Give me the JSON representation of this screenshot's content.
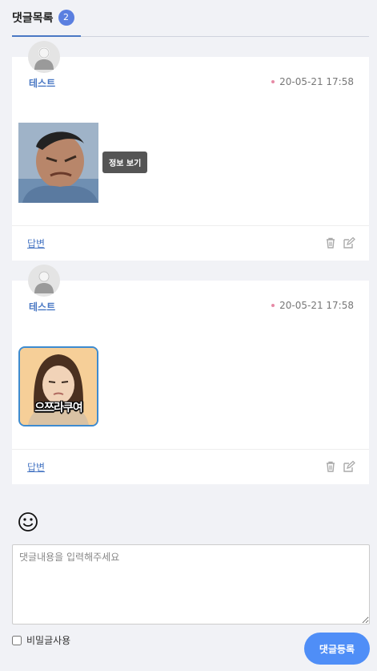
{
  "header": {
    "tab_label": "댓글목록",
    "count": "2"
  },
  "comments": [
    {
      "author": "테스트",
      "date": "20-05-21 17:58",
      "image": "photo-icon",
      "tooltip": "정보 보기",
      "reply_label": "답변"
    },
    {
      "author": "테스트",
      "date": "20-05-21 17:58",
      "image": "sticker-icon",
      "caption": "으쯔라쿠여",
      "reply_label": "답변"
    }
  ],
  "compose": {
    "emoji": "smiley-icon",
    "placeholder": "댓글내용을 입력해주세요",
    "value": "",
    "secret_label": "비밀글사용",
    "secret_checked": false,
    "submit_label": "댓글등록"
  },
  "colors": {
    "accent": "#4a78c4",
    "badge": "#5a7fe0",
    "submit": "#4f8ef7",
    "date_dot": "#e68aa6",
    "background": "#f1f2f6"
  }
}
